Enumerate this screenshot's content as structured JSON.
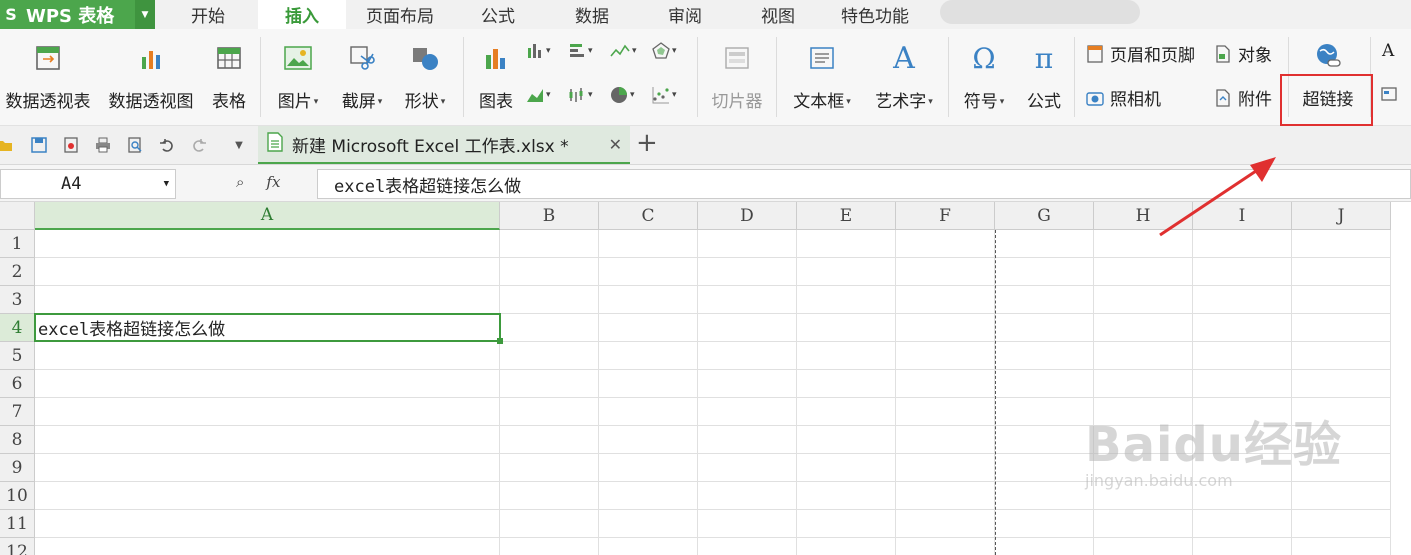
{
  "app": {
    "name": "WPS 表格"
  },
  "menu": {
    "tabs": [
      "开始",
      "插入",
      "页面布局",
      "公式",
      "数据",
      "审阅",
      "视图",
      "特色功能"
    ],
    "active": "插入"
  },
  "ribbon": {
    "pivot_table": "数据透视表",
    "pivot_chart": "数据透视图",
    "table": "表格",
    "picture": "图片",
    "screenshot": "截屏",
    "shapes": "形状",
    "chart": "图表",
    "slicer": "切片器",
    "textbox": "文本框",
    "wordart": "艺术字",
    "symbol": "符号",
    "formula": "公式",
    "header_footer": "页眉和页脚",
    "object": "对象",
    "camera": "照相机",
    "attachment": "附件",
    "hyperlink": "超链接",
    "overflow_label": "A"
  },
  "document_tab": {
    "title": "新建 Microsoft Excel 工作表.xlsx *"
  },
  "formula_bar": {
    "name_box": "A4",
    "fx": "fx",
    "content": "excel表格超链接怎么做"
  },
  "sheet": {
    "columns": [
      "A",
      "B",
      "C",
      "D",
      "E",
      "F",
      "G",
      "H",
      "I",
      "J"
    ],
    "rows": [
      "1",
      "2",
      "3",
      "4",
      "5",
      "6",
      "7",
      "8",
      "9",
      "10",
      "11",
      "12"
    ],
    "active_cell": "A4",
    "cells": {
      "A4": "excel表格超链接怎么做"
    }
  },
  "colors": {
    "accent": "#4ca64c",
    "highlight_box": "#e03030",
    "annotation_arrow": "#e03030"
  },
  "watermark": {
    "main": "Baidu经验",
    "sub": "jingyan.baidu.com"
  }
}
